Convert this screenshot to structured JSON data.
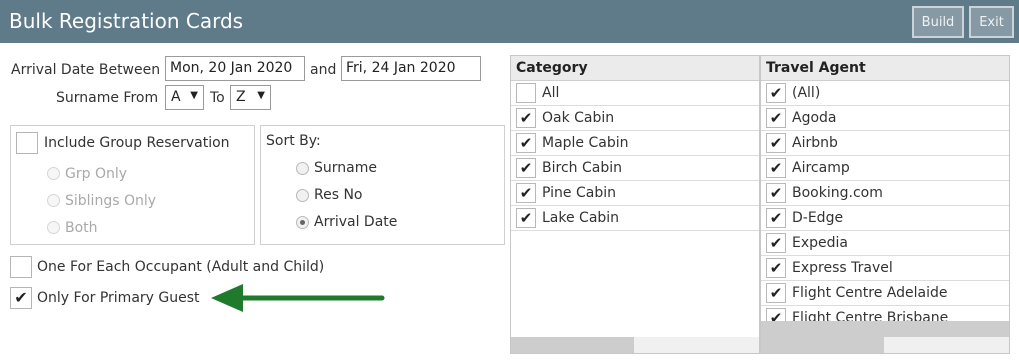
{
  "window": {
    "title": "Bulk Registration Cards",
    "build_label": "Build",
    "exit_label": "Exit"
  },
  "filters": {
    "arrival_label": "Arrival Date Between",
    "date_from": "Mon, 20 Jan 2020",
    "and_label": "and",
    "date_to": "Fri, 24 Jan 2020",
    "surname_label": "Surname From",
    "surname_from": "A",
    "to_label": "To",
    "surname_to": "Z"
  },
  "group": {
    "include_label": "Include Group Reservation",
    "include_checked": false,
    "options": [
      {
        "label": "Grp Only"
      },
      {
        "label": "Siblings Only"
      },
      {
        "label": "Both"
      }
    ]
  },
  "sort": {
    "label": "Sort By:",
    "options": [
      {
        "label": "Surname",
        "selected": false
      },
      {
        "label": "Res No",
        "selected": false
      },
      {
        "label": "Arrival Date",
        "selected": true
      }
    ]
  },
  "options": {
    "each_occupant_label": "One For Each Occupant (Adult and Child)",
    "each_occupant_checked": false,
    "primary_guest_label": "Only For Primary Guest",
    "primary_guest_checked": true
  },
  "category": {
    "header": "Category",
    "items": [
      {
        "label": "All",
        "checked": false
      },
      {
        "label": "Oak Cabin",
        "checked": true
      },
      {
        "label": "Maple Cabin",
        "checked": true
      },
      {
        "label": "Birch Cabin",
        "checked": true
      },
      {
        "label": "Pine Cabin",
        "checked": true
      },
      {
        "label": "Lake Cabin",
        "checked": true
      }
    ]
  },
  "travel_agent": {
    "header": "Travel Agent",
    "items": [
      {
        "label": "(All)",
        "checked": true
      },
      {
        "label": "Agoda",
        "checked": true
      },
      {
        "label": "Airbnb",
        "checked": true
      },
      {
        "label": "Aircamp",
        "checked": true
      },
      {
        "label": "Booking.com",
        "checked": true
      },
      {
        "label": "D-Edge",
        "checked": true
      },
      {
        "label": "Expedia",
        "checked": true
      },
      {
        "label": "Express Travel",
        "checked": true
      },
      {
        "label": "Flight Centre Adelaide",
        "checked": true
      },
      {
        "label": "Flight Centre Brisbane",
        "checked": true
      }
    ]
  },
  "colors": {
    "titlebar": "#5f7a89",
    "arrow": "#1f7a2b"
  },
  "check_glyph": "✔"
}
